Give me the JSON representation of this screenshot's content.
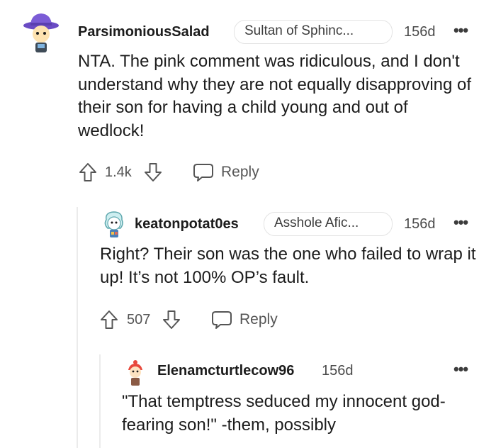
{
  "comments": [
    {
      "username": "ParsimoniousSalad",
      "flair": "Sultan of Sphinc...",
      "age": "156d",
      "body": "NTA. The pink comment was ridiculous, and I don't understand why they are not equally disapproving of their son for having a child young and out of wedlock!",
      "votes": "1.4k",
      "reply_label": "Reply"
    },
    {
      "username": "keatonpotat0es",
      "flair": "Asshole Afic...",
      "age": "156d",
      "body": "Right? Their son was the one who failed to wrap it up! It’s not 100% OP’s fault.",
      "votes": "507",
      "reply_label": "Reply"
    },
    {
      "username": "Elenamcturtlecow96",
      "age": "156d",
      "body": "\"That temptress seduced my innocent god-fearing son!\" -them, possibly"
    }
  ],
  "more_glyph": "•••",
  "icons": {
    "upvote": "upvote-arrow-icon",
    "downvote": "downvote-arrow-icon",
    "reply": "speech-bubble-icon",
    "more": "more-options-icon"
  },
  "colors": {
    "text": "#1c1c1c",
    "muted": "#555555",
    "flair_border": "#e3e3e3",
    "thread_line": "#ebebeb",
    "avatar1_hat": "#7b5cd6"
  }
}
